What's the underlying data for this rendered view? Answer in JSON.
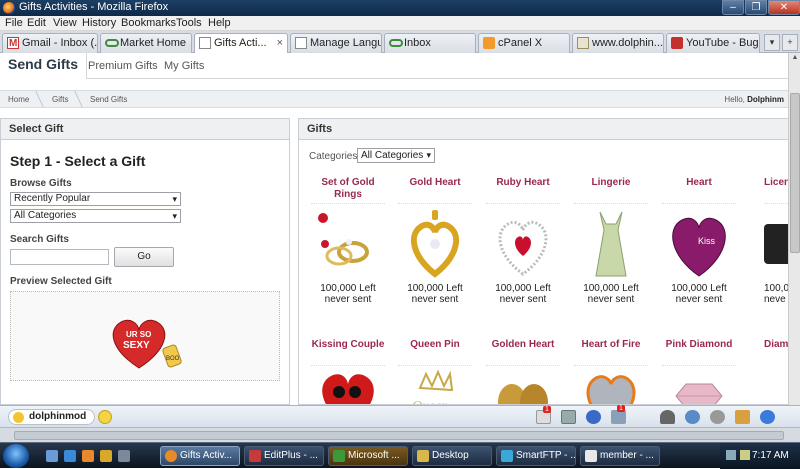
{
  "window": {
    "title": "Gifts Activities - Mozilla Firefox",
    "minimize": "–",
    "maximize": "❐",
    "close": "✕"
  },
  "menu": [
    "File",
    "Edit",
    "View",
    "History",
    "Bookmarks",
    "Tools",
    "Help"
  ],
  "tabs": [
    {
      "label": "Gmail - Inbox (...",
      "icon": "gmail-icon"
    },
    {
      "label": "Market Home",
      "icon": "link-icon"
    },
    {
      "label": "Gifts Acti...",
      "icon": "page-icon",
      "active": true
    },
    {
      "label": "Manage Langu...",
      "icon": "page-icon"
    },
    {
      "label": "Inbox",
      "icon": "link-icon"
    },
    {
      "label": "cPanel X",
      "icon": "cpanel-icon"
    },
    {
      "label": "www.dolphin...",
      "icon": "phpmyadmin-icon"
    },
    {
      "label": "YouTube - Bug...",
      "icon": "youtube-icon"
    }
  ],
  "tab_close": "×",
  "page_tabs": {
    "send": "Send Gifts",
    "premium": "Premium Gifts",
    "my": "My Gifts"
  },
  "breadcrumb": {
    "home": "Home",
    "gifts": "Gifts",
    "send": "Send Gifts",
    "hello_prefix": "Hello,",
    "user": "Dolphinm"
  },
  "select_gift": {
    "header": "Select Gift",
    "step": "Step 1 - Select a Gift",
    "browse_label": "Browse Gifts",
    "browse_value": "Recently Popular",
    "category_value": "All Categories",
    "search_label": "Search Gifts",
    "go": "Go",
    "preview_label": "Preview Selected Gift"
  },
  "gifts_panel": {
    "header": "Gifts",
    "categories_label": "Categories",
    "categories_value": "All Categories"
  },
  "gifts_row1": [
    {
      "name": "Set of Gold Rings",
      "left": "100,000 Left",
      "sent": "never sent"
    },
    {
      "name": "Gold Heart",
      "left": "100,000 Left",
      "sent": "never sent"
    },
    {
      "name": "Ruby Heart",
      "left": "100,000 Left",
      "sent": "never sent"
    },
    {
      "name": "Lingerie",
      "left": "100,000 Left",
      "sent": "never sent"
    },
    {
      "name": "Heart",
      "left": "100,000 Left",
      "sent": "never sent"
    },
    {
      "name": "Licen",
      "left": "100,0",
      "sent": "neve"
    }
  ],
  "gifts_row2": [
    {
      "name": "Kissing Couple"
    },
    {
      "name": "Queen Pin"
    },
    {
      "name": "Golden Heart"
    },
    {
      "name": "Heart of Fire"
    },
    {
      "name": "Pink Diamond"
    },
    {
      "name": "Diam"
    }
  ],
  "chat": {
    "user": "dolphinmod",
    "badge1": "1",
    "badge2": "1"
  },
  "taskbar": {
    "tasks": [
      "Gifts Activ...",
      "EditPlus - ...",
      "Microsoft ...",
      "Desktop",
      "SmartFTP - ...",
      "member - ..."
    ],
    "time": "7:17 AM"
  },
  "colors": {
    "gift_name": "#9a2850",
    "accent": "#2c3a4a"
  }
}
